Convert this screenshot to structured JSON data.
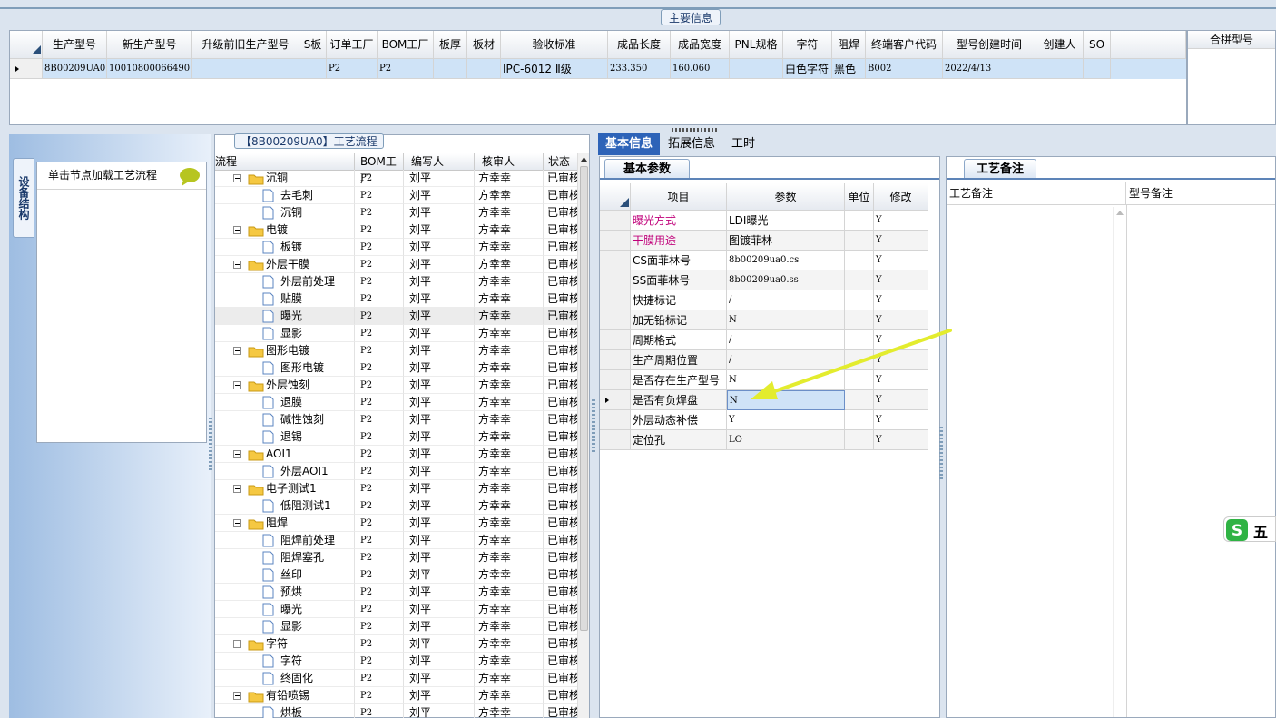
{
  "top": {
    "section_title": "主要信息",
    "columns": [
      "生产型号",
      "新生产型号",
      "升级前旧生产型号",
      "S板",
      "订单工厂",
      "BOM工厂",
      "板厚",
      "板材",
      "验收标准",
      "成品长度",
      "成品宽度",
      "PNL规格",
      "字符",
      "阻焊",
      "终端客户代码",
      "型号创建时间",
      "创建人",
      "SO"
    ],
    "row": [
      "8B00209UA0",
      "10010800066490",
      "",
      "",
      "P2",
      "P2",
      "",
      "",
      "IPC-6012 Ⅱ级",
      "233.350",
      "160.060",
      "",
      "白色字符",
      "黑色",
      "B002",
      "2022/4/13",
      "",
      ""
    ],
    "merge_label": "合拼型号"
  },
  "left": {
    "vertical_tab": "设备结构",
    "click_hint": "单击节点加载工艺流程"
  },
  "tree": {
    "title": "【8B00209UA0】工艺流程",
    "headers": [
      "流程",
      "BOM工厂",
      "编写人",
      "核审人",
      "状态"
    ],
    "rows": [
      {
        "name": "沉铜",
        "type": "folder",
        "bom": "P2",
        "writer": "刘平",
        "reviewer": "方幸幸",
        "status": "已审核"
      },
      {
        "name": "去毛刺",
        "type": "file",
        "bom": "P2",
        "writer": "刘平",
        "reviewer": "方幸幸",
        "status": "已审核"
      },
      {
        "name": "沉铜",
        "type": "file",
        "bom": "P2",
        "writer": "刘平",
        "reviewer": "方幸幸",
        "status": "已审核"
      },
      {
        "name": "电镀",
        "type": "folder",
        "bom": "P2",
        "writer": "刘平",
        "reviewer": "方幸幸",
        "status": "已审核"
      },
      {
        "name": "板镀",
        "type": "file",
        "bom": "P2",
        "writer": "刘平",
        "reviewer": "方幸幸",
        "status": "已审核"
      },
      {
        "name": "外层干膜",
        "type": "folder",
        "bom": "P2",
        "writer": "刘平",
        "reviewer": "方幸幸",
        "status": "已审核"
      },
      {
        "name": "外层前处理",
        "type": "file",
        "bom": "P2",
        "writer": "刘平",
        "reviewer": "方幸幸",
        "status": "已审核"
      },
      {
        "name": "贴膜",
        "type": "file",
        "bom": "P2",
        "writer": "刘平",
        "reviewer": "方幸幸",
        "status": "已审核"
      },
      {
        "name": "曝光",
        "type": "file",
        "bom": "P2",
        "writer": "刘平",
        "reviewer": "方幸幸",
        "status": "已审核"
      },
      {
        "name": "显影",
        "type": "file",
        "bom": "P2",
        "writer": "刘平",
        "reviewer": "方幸幸",
        "status": "已审核"
      },
      {
        "name": "图形电镀",
        "type": "folder",
        "bom": "P2",
        "writer": "刘平",
        "reviewer": "方幸幸",
        "status": "已审核"
      },
      {
        "name": "图形电镀",
        "type": "file",
        "bom": "P2",
        "writer": "刘平",
        "reviewer": "方幸幸",
        "status": "已审核"
      },
      {
        "name": "外层蚀刻",
        "type": "folder",
        "bom": "P2",
        "writer": "刘平",
        "reviewer": "方幸幸",
        "status": "已审核"
      },
      {
        "name": "退膜",
        "type": "file",
        "bom": "P2",
        "writer": "刘平",
        "reviewer": "方幸幸",
        "status": "已审核"
      },
      {
        "name": "碱性蚀刻",
        "type": "file",
        "bom": "P2",
        "writer": "刘平",
        "reviewer": "方幸幸",
        "status": "已审核"
      },
      {
        "name": "退锡",
        "type": "file",
        "bom": "P2",
        "writer": "刘平",
        "reviewer": "方幸幸",
        "status": "已审核"
      },
      {
        "name": "AOI1",
        "type": "folder",
        "bom": "P2",
        "writer": "刘平",
        "reviewer": "方幸幸",
        "status": "已审核"
      },
      {
        "name": "外层AOI1",
        "type": "file",
        "bom": "P2",
        "writer": "刘平",
        "reviewer": "方幸幸",
        "status": "已审核"
      },
      {
        "name": "电子测试1",
        "type": "folder",
        "bom": "P2",
        "writer": "刘平",
        "reviewer": "方幸幸",
        "status": "已审核"
      },
      {
        "name": "低阻测试1",
        "type": "file",
        "bom": "P2",
        "writer": "刘平",
        "reviewer": "方幸幸",
        "status": "已审核"
      },
      {
        "name": "阻焊",
        "type": "folder",
        "bom": "P2",
        "writer": "刘平",
        "reviewer": "方幸幸",
        "status": "已审核"
      },
      {
        "name": "阻焊前处理",
        "type": "file",
        "bom": "P2",
        "writer": "刘平",
        "reviewer": "方幸幸",
        "status": "已审核"
      },
      {
        "name": "阻焊塞孔",
        "type": "file",
        "bom": "P2",
        "writer": "刘平",
        "reviewer": "方幸幸",
        "status": "已审核"
      },
      {
        "name": "丝印",
        "type": "file",
        "bom": "P2",
        "writer": "刘平",
        "reviewer": "方幸幸",
        "status": "已审核"
      },
      {
        "name": "预烘",
        "type": "file",
        "bom": "P2",
        "writer": "刘平",
        "reviewer": "方幸幸",
        "status": "已审核"
      },
      {
        "name": "曝光",
        "type": "file",
        "bom": "P2",
        "writer": "刘平",
        "reviewer": "方幸幸",
        "status": "已审核"
      },
      {
        "name": "显影",
        "type": "file",
        "bom": "P2",
        "writer": "刘平",
        "reviewer": "方幸幸",
        "status": "已审核"
      },
      {
        "name": "字符",
        "type": "folder",
        "bom": "P2",
        "writer": "刘平",
        "reviewer": "方幸幸",
        "status": "已审核"
      },
      {
        "name": "字符",
        "type": "file",
        "bom": "P2",
        "writer": "刘平",
        "reviewer": "方幸幸",
        "status": "已审核"
      },
      {
        "name": "终固化",
        "type": "file",
        "bom": "P2",
        "writer": "刘平",
        "reviewer": "方幸幸",
        "status": "已审核"
      },
      {
        "name": "有铅喷锡",
        "type": "folder",
        "bom": "P2",
        "writer": "刘平",
        "reviewer": "方幸幸",
        "status": "已审核"
      },
      {
        "name": "烘板",
        "type": "file",
        "bom": "P2",
        "writer": "刘平",
        "reviewer": "方幸幸",
        "status": "已审核"
      }
    ]
  },
  "tabs": [
    "基本信息",
    "拓展信息",
    "工时"
  ],
  "basic": {
    "subtab": "基本参数",
    "headers": [
      "项目",
      "参数",
      "单位",
      "修改"
    ],
    "rows": [
      {
        "item": "曝光方式",
        "param": "LDI曝光",
        "unit": "",
        "mod": "Y",
        "highlight": true
      },
      {
        "item": "干膜用途",
        "param": "图镀菲林",
        "unit": "",
        "mod": "Y",
        "highlight": true
      },
      {
        "item": "CS面菲林号",
        "param": "8b00209ua0.cs",
        "unit": "",
        "mod": "Y",
        "highlight": false
      },
      {
        "item": "SS面菲林号",
        "param": "8b00209ua0.ss",
        "unit": "",
        "mod": "Y",
        "highlight": false
      },
      {
        "item": "快捷标记",
        "param": "/",
        "unit": "",
        "mod": "Y",
        "highlight": false
      },
      {
        "item": "加无铅标记",
        "param": "N",
        "unit": "",
        "mod": "Y",
        "highlight": false
      },
      {
        "item": "周期格式",
        "param": "/",
        "unit": "",
        "mod": "Y",
        "highlight": false
      },
      {
        "item": "生产周期位置",
        "param": "/",
        "unit": "",
        "mod": "Y",
        "highlight": false
      },
      {
        "item": "是否存在生产型号",
        "param": "N",
        "unit": "",
        "mod": "Y",
        "highlight": false
      },
      {
        "item": "是否有负焊盘",
        "param": "N",
        "unit": "",
        "mod": "Y",
        "highlight": false
      },
      {
        "item": "外层动态补偿",
        "param": "Y",
        "unit": "",
        "mod": "Y",
        "highlight": false
      },
      {
        "item": "定位孔",
        "param": "LO",
        "unit": "",
        "mod": "Y",
        "highlight": false
      }
    ]
  },
  "notes": {
    "subtab": "工艺备注",
    "col1": "工艺备注",
    "col2": "型号备注"
  },
  "ime": {
    "label": "五"
  },
  "colors": {
    "accent": "#2d63b8",
    "highlight_text": "#c0007a",
    "selection": "#cfe3f7",
    "arrow": "#e3ec2e"
  }
}
